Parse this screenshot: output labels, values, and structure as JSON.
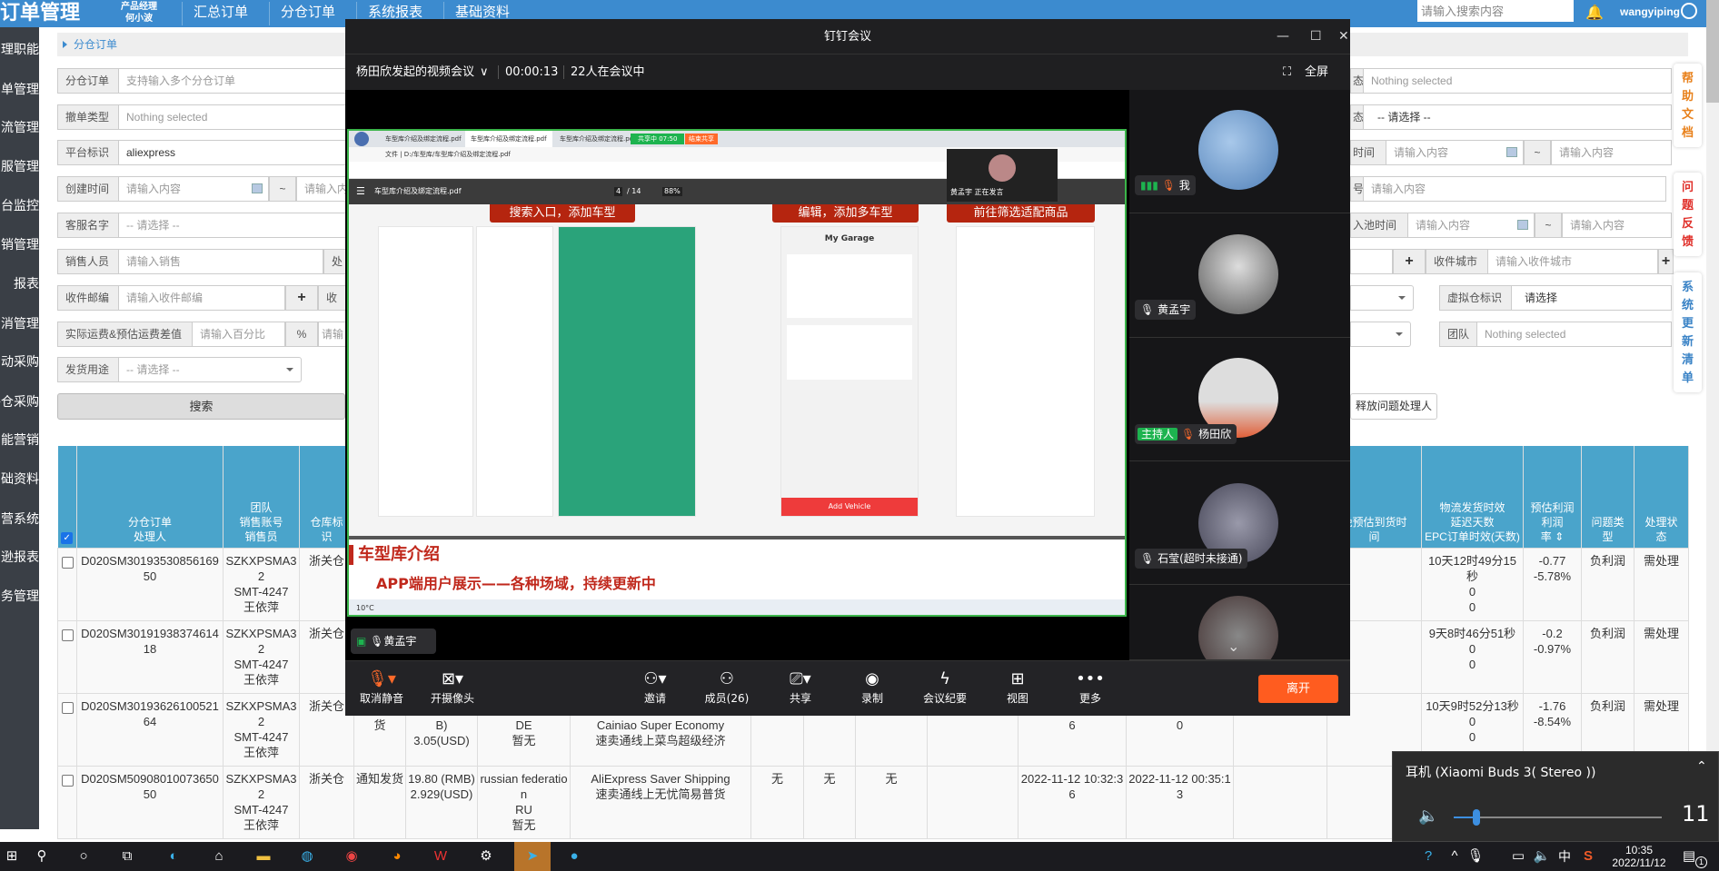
{
  "header": {
    "logo": "订单管理",
    "role_line1": "产品经理",
    "role_line2": "何小波",
    "nav": [
      "汇总订单",
      "分仓订单",
      "系统报表",
      "基础资料"
    ],
    "search_placeholder": "请输入搜索内容",
    "username": "wangyiping"
  },
  "sidebar": [
    "理职能",
    "单管理",
    "流管理",
    "服管理",
    "台监控",
    "销管理",
    "报表",
    "消管理",
    "动采购",
    "补仓采购",
    "能营销",
    "础资料",
    "营系统",
    "马逊报表",
    "务管理"
  ],
  "breadcrumb": "分仓订单",
  "form": {
    "order_label": "分仓订单",
    "order_ph": "支持输入多个分仓订单",
    "cancel_type_label": "撤单类型",
    "cancel_type_val": "Nothing selected",
    "platform_label": "平台标识",
    "platform_val": "aliexpress",
    "created_label": "创建时间",
    "date_ph": "请输入内容",
    "tilde": "~",
    "created_to_ph": "请输入内",
    "cs_label": "客服名字",
    "select_ph": "-- 请选择 --",
    "sales_label": "销售人员",
    "sales_ph": "请输入销售",
    "sales_next": "处",
    "zip_label": "收件邮编",
    "zip_ph": "请输入收件邮编",
    "plus": "+",
    "zip_next": "收",
    "diff_label": "实际运费&预估运费差值",
    "diff_ph": "请输入百分比",
    "percent": "%",
    "diff_next": "请输",
    "use_label": "发货用途",
    "search_btn": "搜索",
    "r1_val": "Nothing selected",
    "r1_label": "态",
    "r2_label": "态",
    "r2_val": "-- 请选择 --",
    "r3_label": "时间",
    "content_ph": "请输入内容",
    "r4_label": "号",
    "r5_label": "入池时间",
    "city_label": "收件城市",
    "city_ph": "请输入收件城市",
    "vw_label": "虚拟仓标识",
    "vw_val": "请选择",
    "team_label": "团队",
    "team_val": "Nothing selected",
    "release_btn": "释放问题处理人"
  },
  "float_tabs": {
    "help": "帮助文档",
    "feedback": "问题反馈",
    "changelog": "系统更新清单"
  },
  "table": {
    "headers": [
      "",
      "分仓订单\n处理人",
      "团队\n销售账号\n销售员",
      "仓库标\n识",
      "",
      "",
      "",
      "",
      "",
      "",
      "",
      "",
      "",
      "",
      "",
      "晚预估到货时\n间",
      "物流发货时效\n延迟天数\nEPC订单时效(天数)",
      "预估利润\n利润\n率 ⇕",
      "问题类\n型",
      "处理状\n态"
    ],
    "rows": [
      [
        "",
        "D020SM3019353085616950",
        "SZKXPSMA32\nSMT-4247\n王依萍",
        "浙关仓",
        "",
        "",
        "",
        "",
        "",
        "",
        "",
        "",
        "",
        "",
        "",
        "",
        "10天12时49分15秒\n0\n0",
        "-0.77\n-5.78%",
        "负利润",
        "需处理"
      ],
      [
        "",
        "D020SM3019193837461418",
        "SZKXPSMA32\nSMT-4247\n王依萍",
        "浙关仓",
        "",
        "",
        "",
        "",
        "",
        "",
        "",
        "",
        "",
        "",
        "",
        "",
        "9天8时46分51秒\n0\n0",
        "-0.2\n-0.97%",
        "负利润",
        "需处理"
      ],
      [
        "",
        "D020SM3019362610052164",
        "SZKXPSMA32\nSMT-4247\n王依萍",
        "浙关仓",
        "货",
        "B)\n3.05(USD)",
        "DE\n暂无",
        "Cainiao Super Economy\n速卖通线上菜鸟超级经济",
        "",
        "",
        "",
        "",
        "6",
        "0",
        "",
        "",
        "10天9时52分13秒\n0\n0",
        "-1.76\n-8.54%",
        "负利润",
        "需处理"
      ],
      [
        "",
        "D020SM5090801007365050",
        "SZKXPSMA32\nSMT-4247\n王依萍",
        "浙关仓",
        "通知发货",
        "19.80 (RMB)\n2.929(USD)",
        "russian federation\nRU\n暂无",
        "AliExpress Saver Shipping\n速卖通线上无忧简易普货",
        "无",
        "无",
        "无",
        "",
        "2022-11-12 10:32:36",
        "2022-11-12 00:35:13",
        "",
        "",
        "",
        "",
        "",
        ""
      ]
    ]
  },
  "meeting": {
    "title": "钉钉会议",
    "subject": "杨田欣发起的视频会议",
    "timer": "00:00:13",
    "attendance": "22人在会议中",
    "fullscreen": "全屏",
    "share": {
      "tab1": "车型库介绍及绑定流程.pdf",
      "tab2": "车型库介绍及绑定流程.pdf",
      "tab3": "车型库介绍及绑定流程.pdf",
      "sharing": "共享中 07:50",
      "stop": "结束共享",
      "address": "文件 | D:/车型库/车型库介绍及绑定流程.pdf",
      "pdf_name": "车型库介绍及绑定流程.pdf",
      "page": "4",
      "pages": "/ 14",
      "zoom": "88%",
      "tag1": "搜索入口，添加车型",
      "tag2": "编辑，添加多车型",
      "tag3": "前往筛选适配商品",
      "garage": "My Garage",
      "add_vehicle": "Add Vehicle",
      "speaking": "黄孟宇 正在发言",
      "slide_title": "车型库介绍",
      "bullet": "APP端用户展示——各种场域，持续更新中",
      "weather": "10°C"
    },
    "speaker": "黄孟宇",
    "participants": [
      {
        "name": "我",
        "muted": true
      },
      {
        "name": "黄孟宇",
        "muted": false
      },
      {
        "name": "杨田欣",
        "muted": true,
        "host": "主持人"
      },
      {
        "name": "石莹(超时未接通)",
        "muted": false
      }
    ],
    "toolbar": [
      "取消静音",
      "开摄像头",
      "邀请",
      "成员(26)",
      "共享",
      "录制",
      "会议纪要",
      "视图",
      "更多"
    ],
    "leave": "离开"
  },
  "volume": {
    "device": "耳机 (Xiaomi Buds 3( Stereo ))",
    "level": 11
  },
  "taskbar": {
    "time": "10:35",
    "date": "2022/11/12",
    "ime": "中",
    "notifications": "1"
  },
  "colors": {
    "header": "#3c8bcf",
    "table_header": "#4aa4cb",
    "leave": "#ff5c1f",
    "sidebar": "#3a3f46"
  }
}
